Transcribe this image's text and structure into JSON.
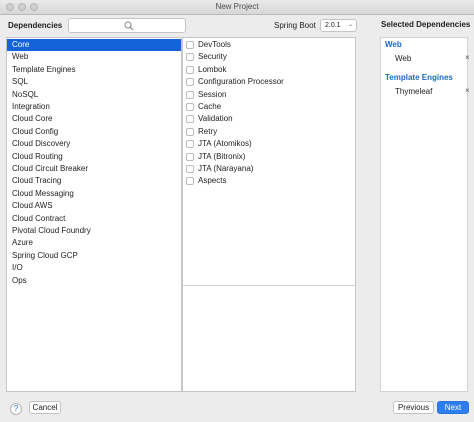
{
  "window": {
    "title": "New Project"
  },
  "header": {
    "dependencies_label": "Dependencies",
    "search_placeholder": "",
    "spring_boot_label": "Spring Boot",
    "spring_boot_version": "2.0.1"
  },
  "categories": [
    {
      "label": "Core",
      "selected": true
    },
    {
      "label": "Web"
    },
    {
      "label": "Template Engines"
    },
    {
      "label": "SQL"
    },
    {
      "label": "NoSQL"
    },
    {
      "label": "Integration"
    },
    {
      "label": "Cloud Core"
    },
    {
      "label": "Cloud Config"
    },
    {
      "label": "Cloud Discovery"
    },
    {
      "label": "Cloud Routing"
    },
    {
      "label": "Cloud Circuit Breaker"
    },
    {
      "label": "Cloud Tracing"
    },
    {
      "label": "Cloud Messaging"
    },
    {
      "label": "Cloud AWS"
    },
    {
      "label": "Cloud Contract"
    },
    {
      "label": "Pivotal Cloud Foundry"
    },
    {
      "label": "Azure"
    },
    {
      "label": "Spring Cloud GCP"
    },
    {
      "label": "I/O"
    },
    {
      "label": "Ops"
    }
  ],
  "dependencies": [
    {
      "label": "DevTools"
    },
    {
      "label": "Security"
    },
    {
      "label": "Lombok"
    },
    {
      "label": "Configuration Processor"
    },
    {
      "label": "Session"
    },
    {
      "label": "Cache"
    },
    {
      "label": "Validation"
    },
    {
      "label": "Retry"
    },
    {
      "label": "JTA (Atomikos)"
    },
    {
      "label": "JTA (Bitronix)"
    },
    {
      "label": "JTA (Narayana)"
    },
    {
      "label": "Aspects"
    }
  ],
  "selected_panel": {
    "title": "Selected Dependencies",
    "groups": [
      {
        "name": "Web",
        "items": [
          "Web"
        ]
      },
      {
        "name": "Template Engines",
        "items": [
          "Thymeleaf"
        ]
      }
    ],
    "remove_glyph": "×"
  },
  "footer": {
    "help_label": "?",
    "cancel_label": "Cancel",
    "previous_label": "Previous",
    "next_label": "Next"
  },
  "colors": {
    "accent": "#1463d8",
    "group_heading": "#1c6ac9",
    "primary_button": "#2d7ef1"
  }
}
